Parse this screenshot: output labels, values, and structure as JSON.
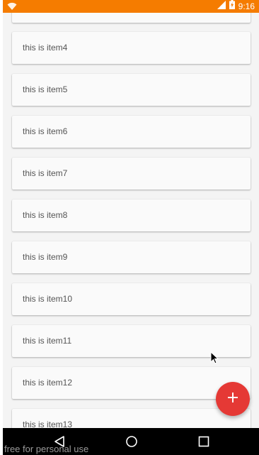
{
  "status_bar": {
    "time": "9:16",
    "icons": [
      "wifi-icon",
      "signal-icon",
      "battery-charging-icon"
    ],
    "color": "#f57c00"
  },
  "list": {
    "items": [
      {
        "label": ""
      },
      {
        "label": "this is item4"
      },
      {
        "label": "this is item5"
      },
      {
        "label": "this is item6"
      },
      {
        "label": "this is item7"
      },
      {
        "label": "this is item8"
      },
      {
        "label": "this is item9"
      },
      {
        "label": "this is item10"
      },
      {
        "label": "this is item11"
      },
      {
        "label": "this is item12"
      },
      {
        "label": "this is item13"
      }
    ]
  },
  "fab": {
    "icon": "plus-icon",
    "color": "#e53935"
  },
  "nav_bar": {
    "buttons": [
      "back-icon",
      "home-icon",
      "recents-icon"
    ]
  },
  "watermark": "free for personal use"
}
